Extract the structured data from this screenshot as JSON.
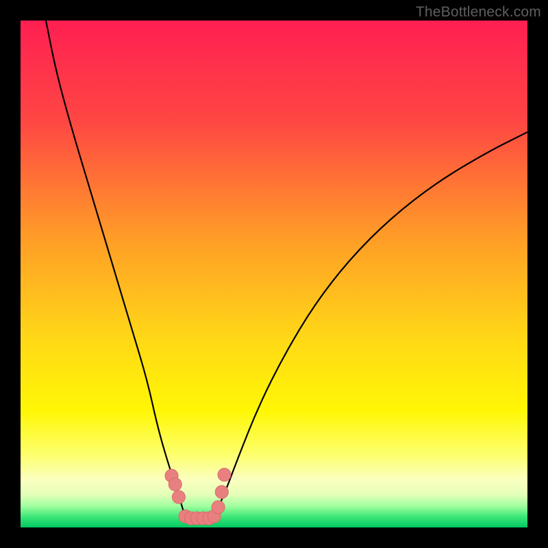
{
  "watermark": "TheBottleneck.com",
  "chart_data": {
    "type": "line",
    "title": "",
    "xlabel": "",
    "ylabel": "",
    "xlim": [
      0,
      100
    ],
    "ylim": [
      0,
      100
    ],
    "grid": false,
    "legend": false,
    "series": [
      {
        "name": "left-branch",
        "x": [
          5,
          7,
          10,
          13,
          16,
          19,
          22,
          25,
          27,
          29,
          31,
          32.5
        ],
        "values": [
          100,
          90,
          79,
          69,
          59,
          49,
          39,
          29,
          20,
          13,
          7,
          2
        ]
      },
      {
        "name": "right-branch",
        "x": [
          38,
          40,
          43,
          47,
          52,
          58,
          65,
          73,
          82,
          92,
          100
        ],
        "values": [
          2,
          6,
          14,
          24,
          34,
          44,
          53,
          61,
          68,
          74,
          78
        ]
      },
      {
        "name": "sample-points-pink",
        "x": [
          29.8,
          30.5,
          31.2,
          32.5,
          33.6,
          34.8,
          36.0,
          37.2,
          38.2,
          39.0,
          39.7,
          40.2
        ],
        "values": [
          10.2,
          8.5,
          6.0,
          2.2,
          1.8,
          1.8,
          1.8,
          1.8,
          2.2,
          4.0,
          7.0,
          10.4
        ]
      }
    ],
    "background": {
      "type": "vertical-gradient",
      "stops": [
        {
          "pos": 0.0,
          "color": "#ff1f52"
        },
        {
          "pos": 0.2,
          "color": "#ff4743"
        },
        {
          "pos": 0.42,
          "color": "#ff9a28"
        },
        {
          "pos": 0.62,
          "color": "#ffd617"
        },
        {
          "pos": 0.77,
          "color": "#fff705"
        },
        {
          "pos": 0.86,
          "color": "#fdff72"
        },
        {
          "pos": 0.905,
          "color": "#fbffbf"
        },
        {
          "pos": 0.935,
          "color": "#e4ffb8"
        },
        {
          "pos": 0.958,
          "color": "#9fff9e"
        },
        {
          "pos": 0.978,
          "color": "#40e878"
        },
        {
          "pos": 1.0,
          "color": "#00c862"
        }
      ]
    },
    "colors": {
      "curve": "#000000",
      "points_fill": "#e98080",
      "points_stroke": "#d86a6a"
    }
  }
}
